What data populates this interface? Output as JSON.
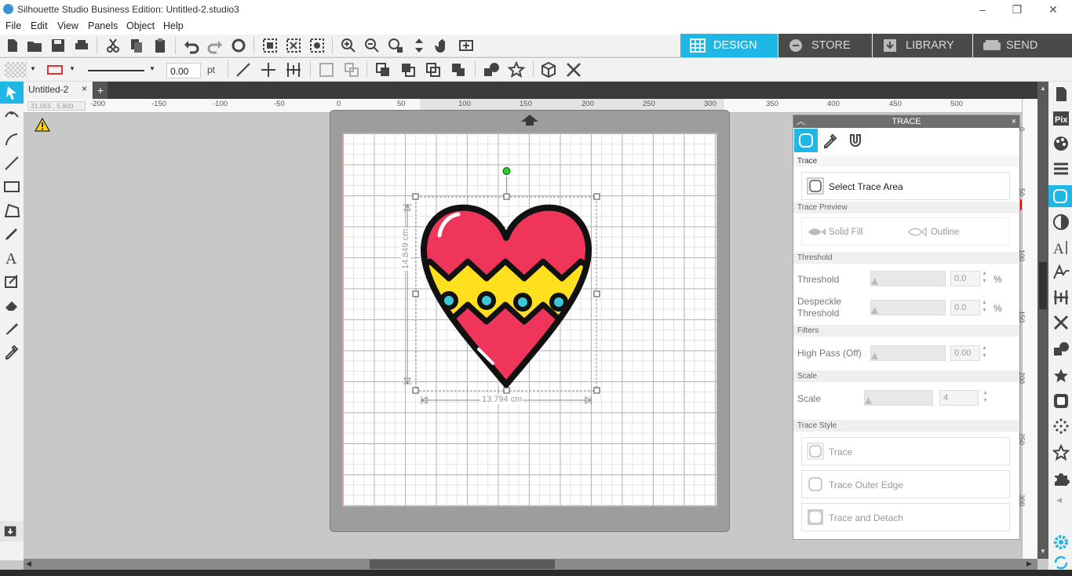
{
  "window": {
    "title": "Silhouette Studio Business Edition: Untitled-2.studio3"
  },
  "menu": [
    "File",
    "Edit",
    "View",
    "Panels",
    "Object",
    "Help"
  ],
  "nav_tabs": [
    {
      "label": "DESIGN",
      "active": true
    },
    {
      "label": "STORE",
      "active": false
    },
    {
      "label": "LIBRARY",
      "active": false
    },
    {
      "label": "SEND",
      "active": false
    }
  ],
  "line_settings": {
    "width_value": "0.00",
    "unit": "pt"
  },
  "document_tab": {
    "label": "Untitled-2",
    "close": "×",
    "add": "+"
  },
  "ruler": {
    "coords": "31.055 , 5.800",
    "h_labels": [
      "-200",
      "-150",
      "-100",
      "-50",
      "0",
      "50",
      "100",
      "150",
      "200",
      "250",
      "300",
      "350",
      "400",
      "450",
      "500"
    ],
    "v_labels": [
      "0",
      "50",
      "100",
      "150",
      "200",
      "250",
      "300"
    ]
  },
  "selection": {
    "height_label": "14.849 cm",
    "width_label": "13.794 cm"
  },
  "trace_panel": {
    "title": "TRACE",
    "close": "×",
    "section_trace": "Trace",
    "select_area_label": "Select Trace Area",
    "section_preview": "Trace Preview",
    "solid_fill": "Solid Fill",
    "outline": "Outline",
    "section_threshold": "Threshold",
    "threshold_label": "Threshold",
    "threshold_value": "0.0",
    "threshold_unit": "%",
    "despeckle_label_1": "Despeckle",
    "despeckle_label_2": "Threshold",
    "despeckle_value": "0.0",
    "despeckle_unit": "%",
    "section_filters": "Filters",
    "highpass_label": "High Pass (Off)",
    "highpass_value": "0.00",
    "section_scale": "Scale",
    "scale_label": "Scale",
    "scale_value": "4",
    "section_style": "Trace Style",
    "trace_btn": "Trace",
    "trace_outer_btn": "Trace Outer Edge",
    "trace_detach_btn": "Trace and Detach"
  },
  "colors": {
    "accent": "#1fb7e6",
    "heart_red": "#f0355a",
    "band_yellow": "#ffe01f",
    "dot_cyan": "#3cc8d8",
    "arrow_red": "#ff0000"
  }
}
